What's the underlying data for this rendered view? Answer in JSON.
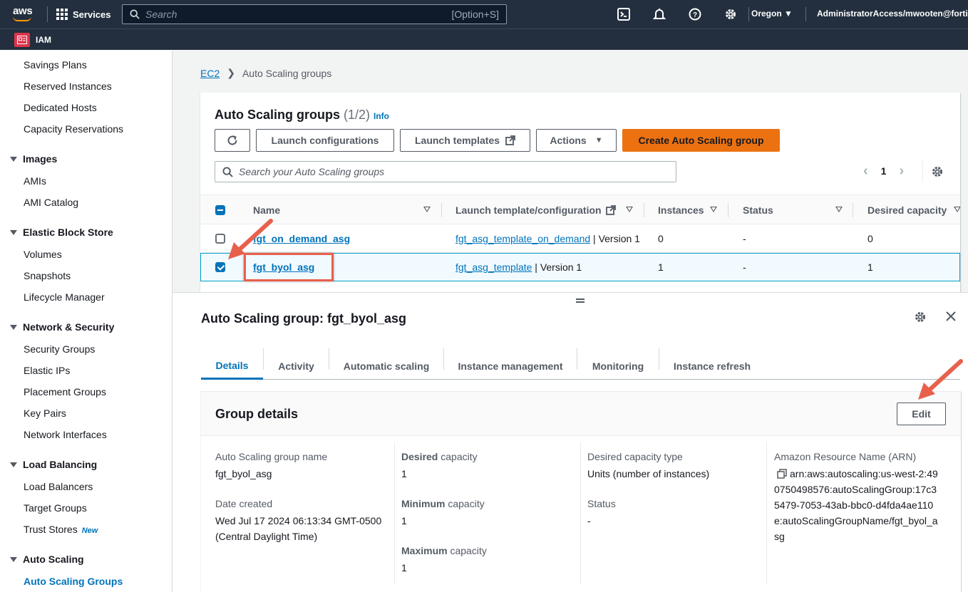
{
  "topnav": {
    "logo_text": "aws",
    "services_label": "Services",
    "search_placeholder": "Search",
    "search_shortcut": "[Option+S]",
    "region": "Oregon",
    "account": "AdministratorAccess/mwooten@fortin"
  },
  "subnav": {
    "service_label": "IAM"
  },
  "sidebar": {
    "items_top": [
      "Savings Plans",
      "Reserved Instances",
      "Dedicated Hosts",
      "Capacity Reservations"
    ],
    "sections": [
      {
        "title": "Images",
        "items": [
          "AMIs",
          "AMI Catalog"
        ]
      },
      {
        "title": "Elastic Block Store",
        "items": [
          "Volumes",
          "Snapshots",
          "Lifecycle Manager"
        ]
      },
      {
        "title": "Network & Security",
        "items": [
          "Security Groups",
          "Elastic IPs",
          "Placement Groups",
          "Key Pairs",
          "Network Interfaces"
        ]
      },
      {
        "title": "Load Balancing",
        "items": [
          "Load Balancers",
          "Target Groups",
          "Trust Stores"
        ]
      },
      {
        "title": "Auto Scaling",
        "items": [
          "Auto Scaling Groups"
        ]
      }
    ],
    "new_badge": "New"
  },
  "breadcrumb": {
    "root": "EC2",
    "current": "Auto Scaling groups"
  },
  "asg_panel": {
    "title": "Auto Scaling groups",
    "count": "(1/2)",
    "info": "Info",
    "buttons": {
      "launch_configurations": "Launch configurations",
      "launch_templates": "Launch templates",
      "actions": "Actions",
      "create": "Create Auto Scaling group"
    },
    "search_placeholder": "Search your Auto Scaling groups",
    "page": "1",
    "columns": {
      "name": "Name",
      "launch_template": "Launch template/configuration",
      "instances": "Instances",
      "status": "Status",
      "desired_capacity": "Desired capacity"
    },
    "rows": [
      {
        "name": "fgt_on_demand_asg",
        "template": "fgt_asg_template_on_demand",
        "version": "| Version 1",
        "instances": "0",
        "status": "-",
        "desired": "0",
        "selected": false
      },
      {
        "name": "fgt_byol_asg",
        "template": "fgt_asg_template",
        "version": "| Version 1",
        "instances": "1",
        "status": "-",
        "desired": "1",
        "selected": true
      }
    ]
  },
  "detail": {
    "title": "Auto Scaling group: fgt_byol_asg",
    "tabs": [
      "Details",
      "Activity",
      "Automatic scaling",
      "Instance management",
      "Monitoring",
      "Instance refresh"
    ],
    "active_tab": "Details",
    "group_details": {
      "title": "Group details",
      "edit": "Edit",
      "asg_name_label": "Auto Scaling group name",
      "asg_name_value": "fgt_byol_asg",
      "date_created_label": "Date created",
      "date_created_value_1": "Wed Jul 17 2024 06:13:34 GMT-0500",
      "date_created_value_2": "(Central Daylight Time)",
      "desired_capacity_label_bold": "Desired",
      "desired_capacity_label_rest": "capacity",
      "desired_capacity_value": "1",
      "minimum_capacity_label_bold": "Minimum",
      "minimum_capacity_label_rest": "capacity",
      "minimum_capacity_value": "1",
      "maximum_capacity_label_bold": "Maximum",
      "maximum_capacity_label_rest": "capacity",
      "maximum_capacity_value": "1",
      "desired_capacity_type_label": "Desired capacity type",
      "desired_capacity_type_value": "Units (number of instances)",
      "status_label": "Status",
      "status_value": "-",
      "arn_label": "Amazon Resource Name (ARN)",
      "arn_line_1": "arn:aws:autoscaling:us-west-2:49",
      "arn_line_2": "0750498576:autoScalingGroup:17c3",
      "arn_line_3": "5479-7053-43ab-bbc0-d4fda4ae110",
      "arn_line_4": "e:autoScalingGroupName/fgt_byol_a",
      "arn_line_5": "sg"
    }
  },
  "colors": {
    "accent": "#0073bb",
    "primary_button": "#ec7211",
    "nav_bg": "#232f3e",
    "annotation": "#e8604c"
  }
}
